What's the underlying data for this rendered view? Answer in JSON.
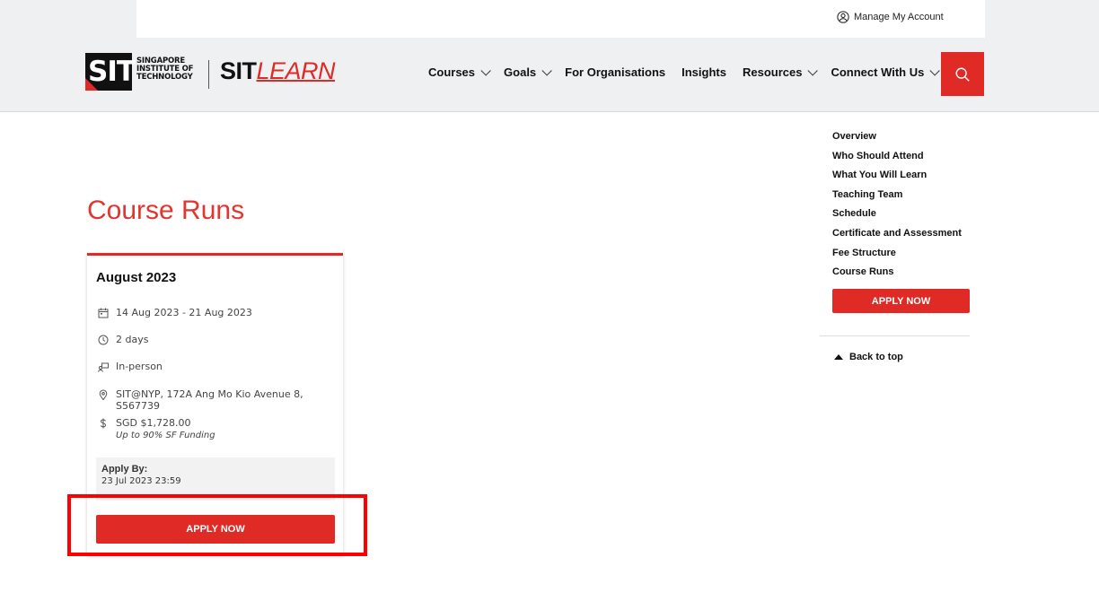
{
  "topbar": {
    "account_label": "Manage My Account"
  },
  "logo": {
    "sit_mark": "SIT",
    "name_line1": "SINGAPORE",
    "name_line2": "INSTITUTE OF",
    "name_line3": "TECHNOLOGY",
    "product_prefix": "SIT",
    "product_suffix": "LEARN"
  },
  "nav": {
    "items": [
      {
        "label": "Courses",
        "dropdown": true
      },
      {
        "label": "Goals",
        "dropdown": true
      },
      {
        "label": "For Organisations",
        "dropdown": false
      },
      {
        "label": "Insights",
        "dropdown": false
      },
      {
        "label": "Resources",
        "dropdown": true
      },
      {
        "label": "Connect With Us",
        "dropdown": true
      }
    ],
    "search_icon": "search-icon"
  },
  "main": {
    "title": "Course Runs",
    "card": {
      "heading": "August 2023",
      "date_range": "14 Aug 2023 - 21 Aug 2023",
      "duration": "2 days",
      "mode": "In-person",
      "location": "SIT@NYP, 172A Ang Mo Kio Avenue 8, S567739",
      "price": "SGD $1,728.00",
      "funding_note": "Up to 90% SF Funding",
      "apply_by_label": "Apply By:",
      "apply_by_value": "23 Jul 2023 23:59",
      "apply_button": "APPLY NOW"
    }
  },
  "sidenav": {
    "links": [
      "Overview",
      "Who Should Attend",
      "What You Will Learn",
      "Teaching Team",
      "Schedule",
      "Certificate and Assessment",
      "Fee Structure",
      "Course Runs"
    ],
    "apply_button": "APPLY NOW",
    "back_to_top": "Back to top"
  },
  "colors": {
    "brand_red": "#e02a26",
    "header_bg": "#eef0f2",
    "highlight": "#ff0000"
  }
}
